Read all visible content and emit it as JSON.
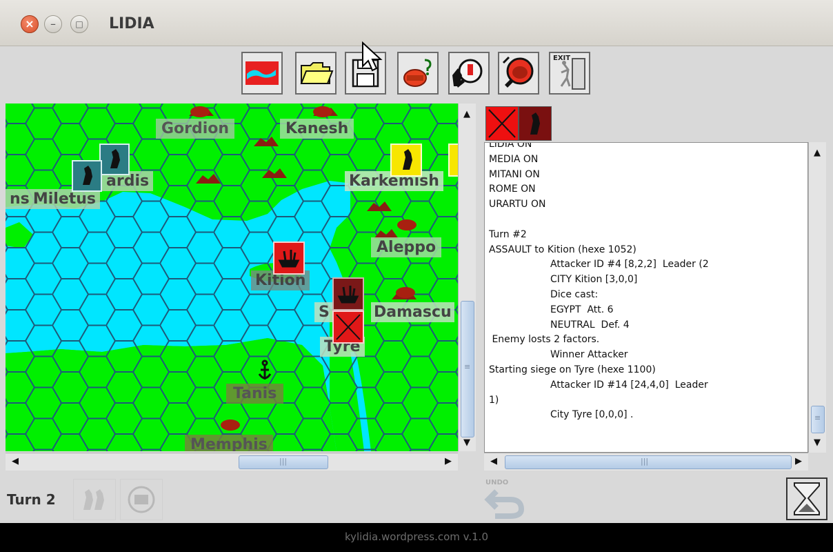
{
  "window": {
    "title": "LIDIA"
  },
  "toolbar": {
    "buttons": [
      {
        "name": "map-view-button",
        "icon": "map-icon"
      },
      {
        "name": "open-button",
        "icon": "folder-icon"
      },
      {
        "name": "save-button",
        "icon": "floppy-disk-icon"
      },
      {
        "name": "city-info-button",
        "icon": "city-question-icon"
      },
      {
        "name": "army-search-button",
        "icon": "army-magnifier-icon"
      },
      {
        "name": "city-search-button",
        "icon": "city-magnifier-icon"
      },
      {
        "name": "exit-button",
        "label": "EXIT",
        "icon": "exit-door-icon"
      }
    ]
  },
  "map": {
    "cities": [
      {
        "name": "Gordion"
      },
      {
        "name": "Kanesh"
      },
      {
        "name": "Sardis",
        "shown": "ardis"
      },
      {
        "name": "Karkemish"
      },
      {
        "name": "Miletus",
        "prefix": "ns"
      },
      {
        "name": "Aleppo"
      },
      {
        "name": "Kition"
      },
      {
        "name": "Sidon",
        "shown": "S"
      },
      {
        "name": "Damascus",
        "shown": "Damascu"
      },
      {
        "name": "Tyre"
      },
      {
        "name": "Tanis"
      },
      {
        "name": "Memphis"
      }
    ]
  },
  "log": {
    "lines": [
      "LIDIA ON",
      "MEDIA ON",
      "MITANI ON",
      "ROME ON",
      "URARTU ON",
      "",
      "Turn #2",
      "ASSAULT to Kition (hexe 1052)",
      "                    Attacker ID #4 [8,2,2]  Leader (2",
      "                    CITY Kition [3,0,0]",
      "                    Dice cast:",
      "                    EGYPT  Att. 6",
      "                    NEUTRAL  Def. 4",
      " Enemy losts 2 factors.",
      "                    Winner Attacker",
      "Starting siege on Tyre (hexe 1100)",
      "                    Attacker ID #14 [24,4,0]  Leader",
      "1)",
      "                    City Tyre [0,0,0] ."
    ]
  },
  "status": {
    "turn_label": "Turn 2"
  },
  "undo": {
    "label": "UNDO"
  },
  "footer": {
    "text": "kylidia.wordpress.com v.1.0"
  },
  "colors": {
    "land": "#00f000",
    "sea": "#00e6ff",
    "hex_line": "#1d5a7a",
    "egypt_red": "#e01818",
    "lidia_teal": "#2b7c84",
    "babylon_yellow": "#f7e600"
  }
}
